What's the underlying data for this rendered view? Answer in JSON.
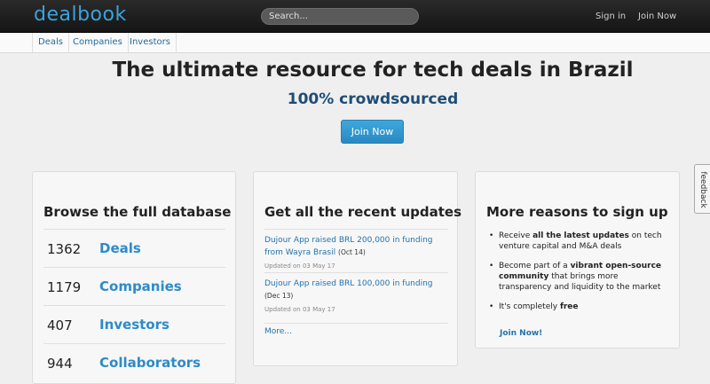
{
  "header": {
    "logo": "dealbook",
    "search_placeholder": "Search...",
    "links": [
      "Sign in",
      "Join Now"
    ]
  },
  "subnav": [
    "Deals",
    "Companies",
    "Investors"
  ],
  "hero": {
    "title": "The ultimate resource for tech deals in Brazil",
    "subtitle": "100% crowdsourced",
    "join_label": "Join Now"
  },
  "browse": {
    "title": "Browse the full database",
    "stats": [
      {
        "count": "1362",
        "label": "Deals"
      },
      {
        "count": "1179",
        "label": "Companies"
      },
      {
        "count": "407",
        "label": "Investors"
      },
      {
        "count": "944",
        "label": "Collaborators"
      }
    ]
  },
  "updates": {
    "title": "Get all the recent updates",
    "items": [
      {
        "text": "Dujour App raised BRL 200,000 in funding from Wayra Brasil",
        "date": "(Oct 14)",
        "meta": "Updated on 03 May 17"
      },
      {
        "text": "Dujour App raised BRL 100,000 in funding",
        "date": "(Dec 13)",
        "meta": "Updated on 03 May 17"
      }
    ],
    "more_label": "More..."
  },
  "reasons": {
    "title": "More reasons to sign up",
    "items": [
      {
        "pre": "Receive ",
        "bold": "all the latest updates",
        "post": " on tech venture capital and M&A deals"
      },
      {
        "pre": "Become part of a ",
        "bold": "vibrant open-source community",
        "post": " that brings more transparency and liquidity to the market"
      },
      {
        "pre": "It's completely ",
        "bold": "free",
        "post": ""
      }
    ],
    "join_label": "Join Now!"
  },
  "feedback_label": "feedback",
  "colors": {
    "accent": "#2d8bc8",
    "topbar": "#1c1c1c",
    "subtitle": "#1f4d75"
  }
}
